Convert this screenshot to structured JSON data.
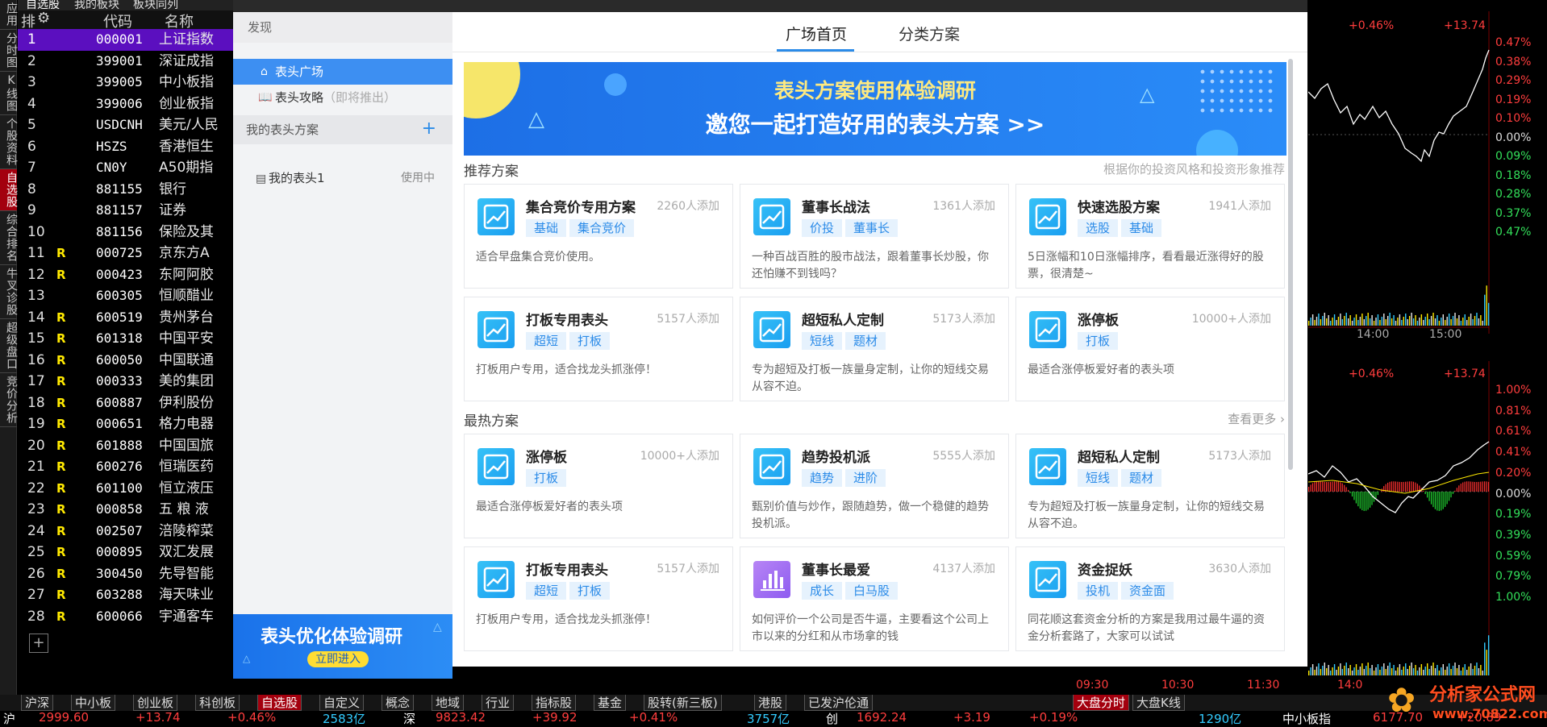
{
  "left_tabs": [
    "应用",
    "分时图",
    "K线图",
    "个股资料",
    "自选股",
    "综合排名",
    "牛叉诊股",
    "超级盘口",
    "竞价分析"
  ],
  "left_tabs_active": "自选股",
  "top_tabs": [
    "自选股",
    "我的板块",
    "板块同列"
  ],
  "stock_table": {
    "headers": {
      "rank": "排",
      "code": "代码",
      "name": "名称"
    },
    "rows": [
      {
        "n": "1",
        "r": "",
        "code": "000001",
        "name": "上证指数"
      },
      {
        "n": "2",
        "r": "",
        "code": "399001",
        "name": "深证成指"
      },
      {
        "n": "3",
        "r": "",
        "code": "399005",
        "name": "中小板指"
      },
      {
        "n": "4",
        "r": "",
        "code": "399006",
        "name": "创业板指"
      },
      {
        "n": "5",
        "r": "",
        "code": "USDCNH",
        "name": "美元/人民"
      },
      {
        "n": "6",
        "r": "",
        "code": "HSZS",
        "name": "香港恒生"
      },
      {
        "n": "7",
        "r": "",
        "code": "CN0Y",
        "name": "A50期指"
      },
      {
        "n": "8",
        "r": "",
        "code": "881155",
        "name": "银行"
      },
      {
        "n": "9",
        "r": "",
        "code": "881157",
        "name": "证券"
      },
      {
        "n": "10",
        "r": "",
        "code": "881156",
        "name": "保险及其"
      },
      {
        "n": "11",
        "r": "R",
        "code": "000725",
        "name": "京东方A"
      },
      {
        "n": "12",
        "r": "R",
        "code": "000423",
        "name": "东阿阿胶"
      },
      {
        "n": "13",
        "r": "",
        "code": "600305",
        "name": "恒顺醋业"
      },
      {
        "n": "14",
        "r": "R",
        "code": "600519",
        "name": "贵州茅台"
      },
      {
        "n": "15",
        "r": "R",
        "code": "601318",
        "name": "中国平安"
      },
      {
        "n": "16",
        "r": "R",
        "code": "600050",
        "name": "中国联通"
      },
      {
        "n": "17",
        "r": "R",
        "code": "000333",
        "name": "美的集团"
      },
      {
        "n": "18",
        "r": "R",
        "code": "600887",
        "name": "伊利股份"
      },
      {
        "n": "19",
        "r": "R",
        "code": "000651",
        "name": "格力电器"
      },
      {
        "n": "20",
        "r": "R",
        "code": "601888",
        "name": "中国国旅"
      },
      {
        "n": "21",
        "r": "R",
        "code": "600276",
        "name": "恒瑞医药"
      },
      {
        "n": "22",
        "r": "R",
        "code": "601100",
        "name": "恒立液压"
      },
      {
        "n": "23",
        "r": "R",
        "code": "000858",
        "name": "五 粮 液"
      },
      {
        "n": "24",
        "r": "R",
        "code": "002507",
        "name": "涪陵榨菜"
      },
      {
        "n": "25",
        "r": "R",
        "code": "000895",
        "name": "双汇发展"
      },
      {
        "n": "26",
        "r": "R",
        "code": "300450",
        "name": "先导智能"
      },
      {
        "n": "27",
        "r": "R",
        "code": "603288",
        "name": "海天味业"
      },
      {
        "n": "28",
        "r": "R",
        "code": "600066",
        "name": "宇通客车"
      }
    ]
  },
  "sidebar": {
    "discover": "发现",
    "items": [
      {
        "label": "表头广场",
        "icon": "home-icon"
      },
      {
        "label": "表头攻略",
        "note": "（即将推出）",
        "icon": "book-icon"
      }
    ],
    "my_schemes": "我的表头方案",
    "add": "+",
    "my_header": {
      "label": "我的表头1",
      "status": "使用中"
    },
    "promo": {
      "title": "表头优化体验调研",
      "button": "立即进入"
    }
  },
  "tabs": [
    "广场首页",
    "分类方案"
  ],
  "active_tab": "广场首页",
  "banner": {
    "line1": "表头方案使用体验调研",
    "line2": "邀您一起打造好用的表头方案 >>"
  },
  "recommended": {
    "title": "推荐方案",
    "hint": "根据你的投资风格和投资形象推荐"
  },
  "hot": {
    "title": "最热方案",
    "more": "查看更多"
  },
  "recommended_cards": [
    {
      "title": "集合竞价专用方案",
      "adds": "2260人添加",
      "tags": [
        "基础",
        "集合竞价"
      ],
      "desc": "适合早盘集合竞价使用。",
      "icon": "chart-icon"
    },
    {
      "title": "董事长战法",
      "adds": "1361人添加",
      "tags": [
        "价投",
        "董事长"
      ],
      "desc": "一种百战百胜的股市战法，跟着董事长炒股，你还怕赚不到钱吗？",
      "icon": "chart-icon"
    },
    {
      "title": "快速选股方案",
      "adds": "1941人添加",
      "tags": [
        "选股",
        "基础"
      ],
      "desc": "5日涨幅和10日涨幅排序，看看最近涨得好的股票，很清楚~",
      "icon": "chart-icon"
    },
    {
      "title": "打板专用表头",
      "adds": "5157人添加",
      "tags": [
        "超短",
        "打板"
      ],
      "desc": "打板用户专用，适合找龙头抓涨停！",
      "icon": "chart-icon"
    },
    {
      "title": "超短私人定制",
      "adds": "5173人添加",
      "tags": [
        "短线",
        "题材"
      ],
      "desc": "专为超短及打板一族量身定制，让你的短线交易从容不迫。",
      "icon": "chart-icon"
    },
    {
      "title": "涨停板",
      "adds": "10000+人添加",
      "tags": [
        "打板"
      ],
      "desc": "最适合涨停板爱好者的表头项",
      "icon": "chart-icon"
    }
  ],
  "hot_cards": [
    {
      "title": "涨停板",
      "adds": "10000+人添加",
      "tags": [
        "打板"
      ],
      "desc": "最适合涨停板爱好者的表头项",
      "icon": "chart-icon"
    },
    {
      "title": "趋势投机派",
      "adds": "5555人添加",
      "tags": [
        "趋势",
        "进阶"
      ],
      "desc": "甄别价值与炒作，跟随趋势，做一个稳健的趋势投机派。",
      "icon": "chart-icon"
    },
    {
      "title": "超短私人定制",
      "adds": "5173人添加",
      "tags": [
        "短线",
        "题材"
      ],
      "desc": "专为超短及打板一族量身定制，让你的短线交易从容不迫。",
      "icon": "chart-icon"
    },
    {
      "title": "打板专用表头",
      "adds": "5157人添加",
      "tags": [
        "超短",
        "打板"
      ],
      "desc": "打板用户专用，适合找龙头抓涨停！",
      "icon": "chart-icon"
    },
    {
      "title": "董事长最爱",
      "adds": "4137人添加",
      "tags": [
        "成长",
        "白马股"
      ],
      "desc": "如何评价一个公司是否牛逼，主要看这个公司上市以来的分红和从市场拿的钱",
      "icon": "bar-chart-icon"
    },
    {
      "title": "资金捉妖",
      "adds": "3630人添加",
      "tags": [
        "投机",
        "资金面"
      ],
      "desc": "同花顺这套资金分析的方案是我用过最牛逼的资金分析套路了，大家可以试试",
      "icon": "chart-icon"
    }
  ],
  "chart_top": {
    "left_label": "+0.46%",
    "right_label": "+13.74",
    "pcts": [
      "0.47%",
      "0.38%",
      "0.29%",
      "0.19%",
      "0.10%",
      "0.00%",
      "0.09%",
      "0.18%",
      "0.28%",
      "0.37%",
      "0.47%"
    ],
    "times": [
      "14:00",
      "15:00"
    ]
  },
  "chart_bottom": {
    "left_label": "+0.46%",
    "right_label": "+13.74",
    "pcts": [
      "1.00%",
      "0.81%",
      "0.61%",
      "0.41%",
      "0.20%",
      "0.00%",
      "0.19%",
      "0.39%",
      "0.59%",
      "0.79%",
      "1.00%"
    ],
    "times": [
      "09:30",
      "10:30",
      "11:30",
      "14:0"
    ]
  },
  "bottom_tabs": [
    "沪深",
    "中小板",
    "创业板",
    "科创板",
    "自选股",
    "自定义",
    "概念",
    "地域",
    "行业",
    "指标股",
    "基金",
    "股转(新三板)",
    "港股",
    "已发沪伦通"
  ],
  "bottom_tabs_active": "自选股",
  "right_tabs": [
    "大盘分时",
    "大盘K线"
  ],
  "status": [
    {
      "t": "沪",
      "c": "#fff"
    },
    {
      "t": "2999.60",
      "c": "#ff3d3d"
    },
    {
      "t": "+13.74",
      "c": "#ff3d3d"
    },
    {
      "t": "+0.46%",
      "c": "#ff3d3d"
    },
    {
      "t": "2583亿",
      "c": "#33ccff"
    },
    {
      "t": "深",
      "c": "#fff"
    },
    {
      "t": "9823.42",
      "c": "#ff3d3d"
    },
    {
      "t": "+39.92",
      "c": "#ff3d3d"
    },
    {
      "t": "+0.41%",
      "c": "#ff3d3d"
    },
    {
      "t": "3757亿",
      "c": "#33ccff"
    },
    {
      "t": "创",
      "c": "#fff"
    },
    {
      "t": "1692.24",
      "c": "#ff3d3d"
    },
    {
      "t": "+3.19",
      "c": "#ff3d3d"
    },
    {
      "t": "+0.19%",
      "c": "#ff3d3d"
    },
    {
      "t": "1290亿",
      "c": "#33ccff"
    },
    {
      "t": "中小板指",
      "c": "#fff"
    },
    {
      "t": "6177.70",
      "c": "#ff3d3d"
    },
    {
      "t": "+20.89",
      "c": "#ff3d3d"
    }
  ],
  "logo": {
    "name": "分析家公式网",
    "url": "www.70822.com"
  }
}
